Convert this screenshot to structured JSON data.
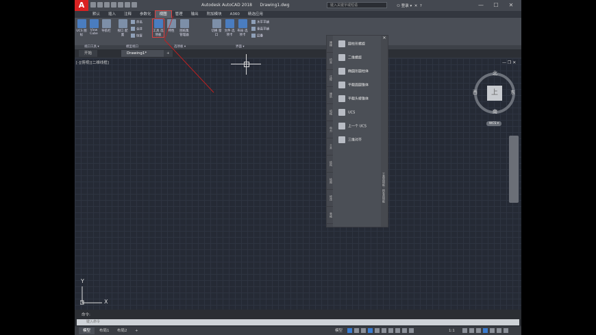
{
  "app": {
    "title": "Autodesk AutoCAD 2018",
    "document": "Drawing1.dwg",
    "logo": "A"
  },
  "search": {
    "placeholder": "键入关键字或短语"
  },
  "login": {
    "label": "登录"
  },
  "window_controls": [
    "—",
    "☐",
    "✕"
  ],
  "menu_tabs": [
    "默认",
    "插入",
    "注释",
    "参数化",
    "视图",
    "管理",
    "输出",
    "附加模块",
    "A360",
    "精选应用"
  ],
  "active_tab_index": 4,
  "ribbon": {
    "buttons": [
      {
        "label": "UCS\n图标"
      },
      {
        "label": "View\nCube"
      },
      {
        "label": "导航栏"
      },
      {
        "label": "视口\n配置"
      },
      {
        "label": "工具\n选项板"
      },
      {
        "label": "特性"
      },
      {
        "label": "图纸集\n管理器"
      },
      {
        "label": "切换\n窗口"
      },
      {
        "label": "文件\n选项卡"
      },
      {
        "label": "布局\n选项卡"
      }
    ],
    "small_items": [
      "命名",
      "合并",
      "恢复",
      "水平平铺",
      "垂直平铺",
      "层叠"
    ],
    "group_titles": [
      "视口工具 ▾",
      "模型视口",
      "选项板 ▾",
      "界面 ▾"
    ]
  },
  "doc_tabs": [
    "开始",
    "Drawing1*",
    "+"
  ],
  "canvas": {
    "view_label": "[-][俯视][二维线框]"
  },
  "palette": {
    "side_tabs": [
      "建模",
      "约束",
      "注释",
      "建筑",
      "机械",
      "电力",
      "土木",
      "结构",
      "绘图",
      "修改",
      "表格"
    ],
    "tools": [
      "圆柱形螺旋",
      "二维螺旋",
      "椭圆形圆柱体",
      "平截面圆锥体",
      "平截头棱锥体",
      "UCS",
      "上一个 UCS",
      "三维对齐"
    ],
    "title": "工具选项板 - 所有选项板"
  },
  "viewcube": {
    "top": "上",
    "north": "北",
    "south": "南",
    "east": "东",
    "west": "西",
    "wcs": "WCS ▾"
  },
  "ucs": {
    "x": "X",
    "y": "Y"
  },
  "command": {
    "history": "命令:",
    "placeholder": "键入命令"
  },
  "status": {
    "tabs": [
      "模型",
      "布局1",
      "布局2",
      "+"
    ],
    "model_label": "模型",
    "scale": "1:1"
  }
}
